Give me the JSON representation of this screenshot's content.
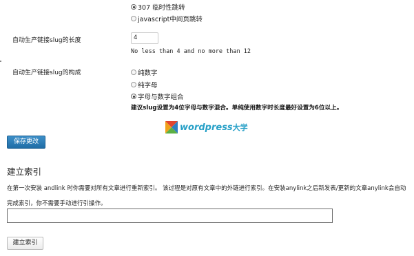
{
  "redirect_options": [
    {
      "label": "307 临时性跳转",
      "checked": true
    },
    {
      "label": "javascript中间页跳转",
      "checked": false
    }
  ],
  "slug_length": {
    "label": "自动生产链接slug的长度",
    "value": "4",
    "hint": "No less than 4 and no more than 12"
  },
  "slug_composition": {
    "label": "自动生产链接slug的构成",
    "options": [
      {
        "label": "纯数字",
        "checked": false
      },
      {
        "label": "纯字母",
        "checked": false
      },
      {
        "label": "字母与数字组合",
        "checked": true
      }
    ],
    "note": "建议slug设置为4位字母与数字混合。单纯使用数字时长度最好设置为6位以上。"
  },
  "watermark": {
    "brand": "wordpress",
    "brand_cn": "大学"
  },
  "save_button": "保存更改",
  "index_section": {
    "title": "建立索引",
    "description": "在第一次安装 andlink 时你需要对所有文章进行重新索引。 该过程是对原有文章中的外链进行索引。在安装anylink之后新发表/更新的文章anylink会自动完成索引，你不需要手动进行引操作。",
    "input_value": "",
    "button": "建立索引"
  }
}
